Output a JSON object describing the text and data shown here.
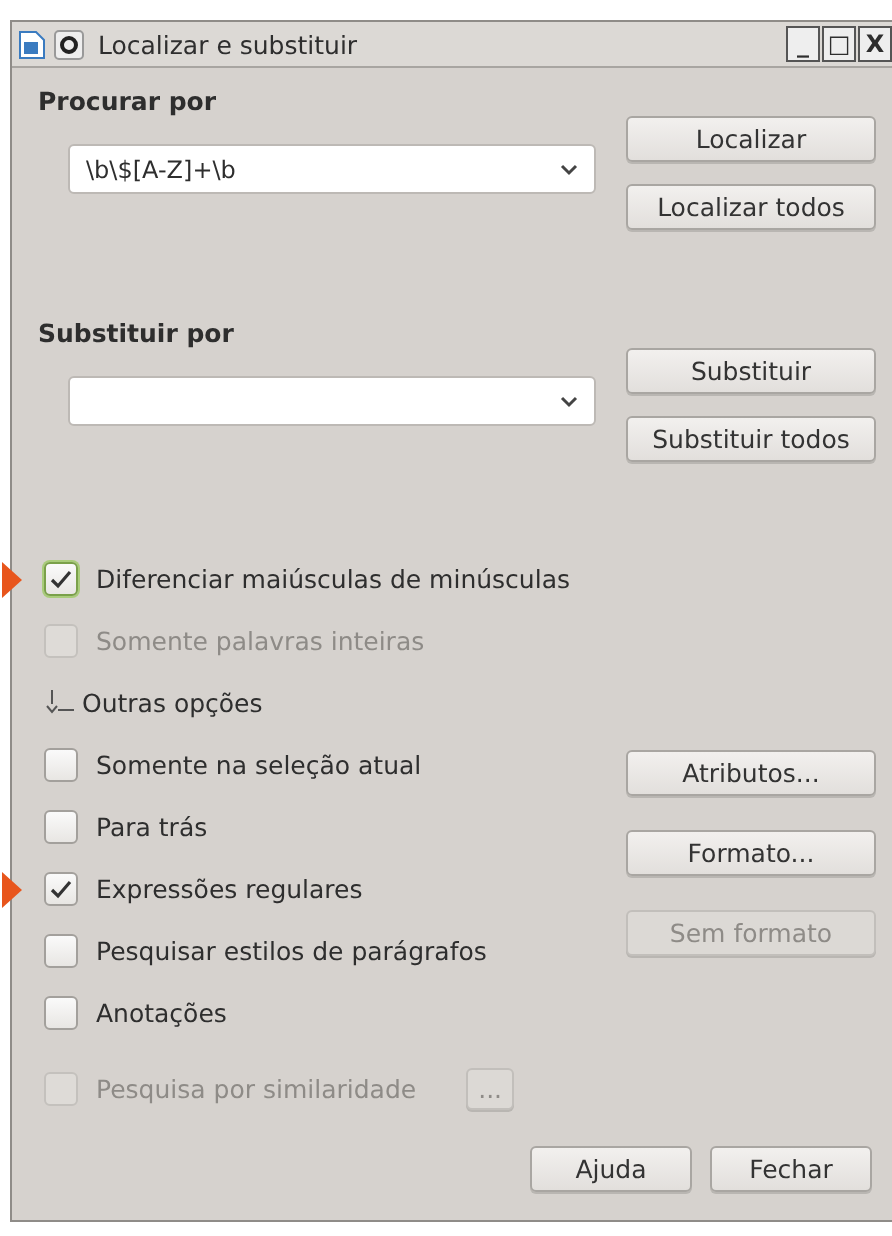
{
  "window": {
    "title": "Localizar e substituir",
    "controls": [
      "_",
      "□",
      "X"
    ]
  },
  "search": {
    "label": "Procurar por",
    "value": "\\b\\$[A-Z]+\\b",
    "buttons": [
      {
        "label": "Localizar",
        "disabled": false
      },
      {
        "label": "Localizar todos",
        "disabled": false
      }
    ]
  },
  "replace": {
    "label": "Substituir por",
    "buttons": [
      {
        "label": "Substituir",
        "disabled": false
      },
      {
        "label": "Substituir todos",
        "disabled": false
      }
    ]
  },
  "options": [
    {
      "kind": "checkbox",
      "label": "Diferenciar maiúsculas de minúsculas",
      "checked": true,
      "disabled": false,
      "focused": true,
      "pointed": true
    },
    {
      "kind": "checkbox",
      "label": "Somente palavras inteiras",
      "checked": false,
      "disabled": true,
      "focused": false,
      "pointed": false
    },
    {
      "kind": "expander",
      "label": "Outras opções",
      "expanded": true
    },
    {
      "kind": "checkbox",
      "label": "Somente na seleção atual",
      "checked": false,
      "disabled": false,
      "focused": false,
      "pointed": false
    },
    {
      "kind": "checkbox",
      "label": "Para trás",
      "checked": false,
      "disabled": false,
      "focused": false,
      "pointed": false
    },
    {
      "kind": "checkbox",
      "label": "Expressões regulares",
      "checked": true,
      "disabled": false,
      "focused": false,
      "pointed": true
    },
    {
      "kind": "checkbox",
      "label": "Pesquisar estilos de parágrafos",
      "checked": false,
      "disabled": false,
      "focused": false,
      "pointed": false
    },
    {
      "kind": "checkbox",
      "label": "Anotações",
      "checked": false,
      "disabled": false,
      "focused": false,
      "pointed": false
    },
    {
      "kind": "checkbox",
      "label": "Pesquisa por similaridade",
      "checked": false,
      "disabled": true,
      "focused": false,
      "pointed": false,
      "button": "..."
    }
  ],
  "side_buttons": [
    {
      "label": "Atributos...",
      "disabled": false
    },
    {
      "label": "Formato...",
      "disabled": false
    },
    {
      "label": "Sem formato",
      "disabled": true
    }
  ],
  "footer_buttons": [
    {
      "label": "Ajuda",
      "disabled": false
    },
    {
      "label": "Fechar",
      "disabled": false
    }
  ]
}
